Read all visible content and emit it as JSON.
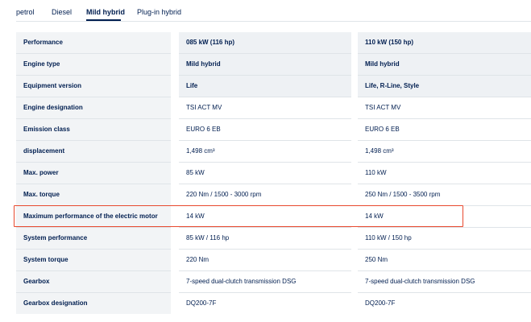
{
  "tabs": [
    {
      "label": "petrol",
      "active": false
    },
    {
      "label": "Diesel",
      "active": false
    },
    {
      "label": "Mild hybrid",
      "active": true
    },
    {
      "label": "Plug-in hybrid",
      "active": false
    }
  ],
  "spec_table": {
    "rows": [
      {
        "label": "Performance",
        "col1": "085 kW (116 hp)",
        "col2": "110 kW (150 hp)"
      },
      {
        "label": "Engine type",
        "col1": "Mild hybrid",
        "col2": "Mild hybrid"
      },
      {
        "label": "Equipment version",
        "col1": "Life",
        "col2": "Life, R-Line, Style"
      },
      {
        "label": "Engine designation",
        "col1": "TSI ACT MV",
        "col2": "TSI ACT MV"
      },
      {
        "label": "Emission class",
        "col1": "EURO 6 EB",
        "col2": "EURO 6 EB"
      },
      {
        "label": "displacement",
        "col1": "1,498 cm³",
        "col2": "1,498 cm³"
      },
      {
        "label": "Max. power",
        "col1": "85 kW",
        "col2": "110 kW"
      },
      {
        "label": "Max. torque",
        "col1": "220 Nm / 1500 - 3000 rpm",
        "col2": "250 Nm / 1500 - 3500 rpm"
      },
      {
        "label": "Maximum performance of the electric motor",
        "col1": "14 kW",
        "col2": "14 kW"
      },
      {
        "label": "System performance",
        "col1": "85 kW / 116 hp",
        "col2": "110 kW / 150 hp"
      },
      {
        "label": "System torque",
        "col1": "220 Nm",
        "col2": "250 Nm"
      },
      {
        "label": "Gearbox",
        "col1": "7-speed dual-clutch transmission DSG",
        "col2": "7-speed dual-clutch transmission DSG"
      },
      {
        "label": "Gearbox designation",
        "col1": "DQ200-7F",
        "col2": "DQ200-7F"
      }
    ]
  },
  "colors": {
    "text": "#001e50",
    "highlight_border": "#e8492e",
    "header_bg": "#eef1f4"
  }
}
